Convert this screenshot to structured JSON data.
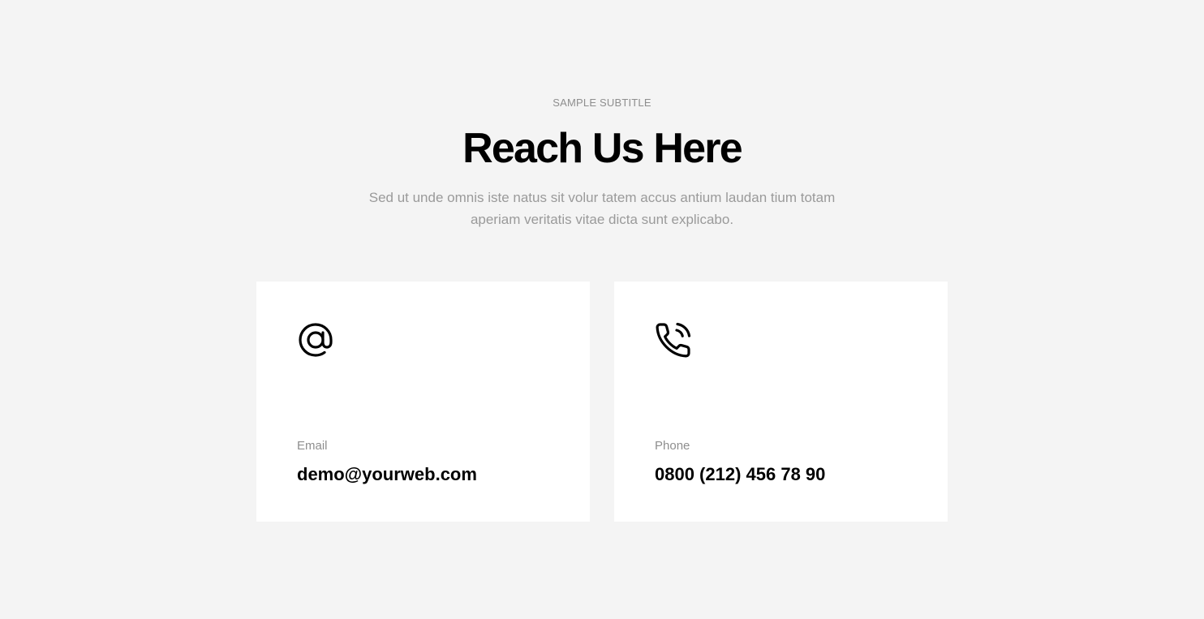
{
  "header": {
    "subtitle": "SAMPLE SUBTITLE",
    "title": "Reach Us Here",
    "description": "Sed ut unde omnis iste natus sit volur tatem accus antium laudan tium totam aperiam veritatis vitae dicta sunt explicabo."
  },
  "cards": [
    {
      "icon": "at-sign-icon",
      "label": "Email",
      "value": "demo@yourweb.com"
    },
    {
      "icon": "phone-call-icon",
      "label": "Phone",
      "value": "0800 (212) 456 78 90"
    }
  ],
  "colors": {
    "background": "#f4f4f4",
    "card": "#ffffff",
    "muted_text": "#8e8e8e",
    "heading": "#000000"
  }
}
